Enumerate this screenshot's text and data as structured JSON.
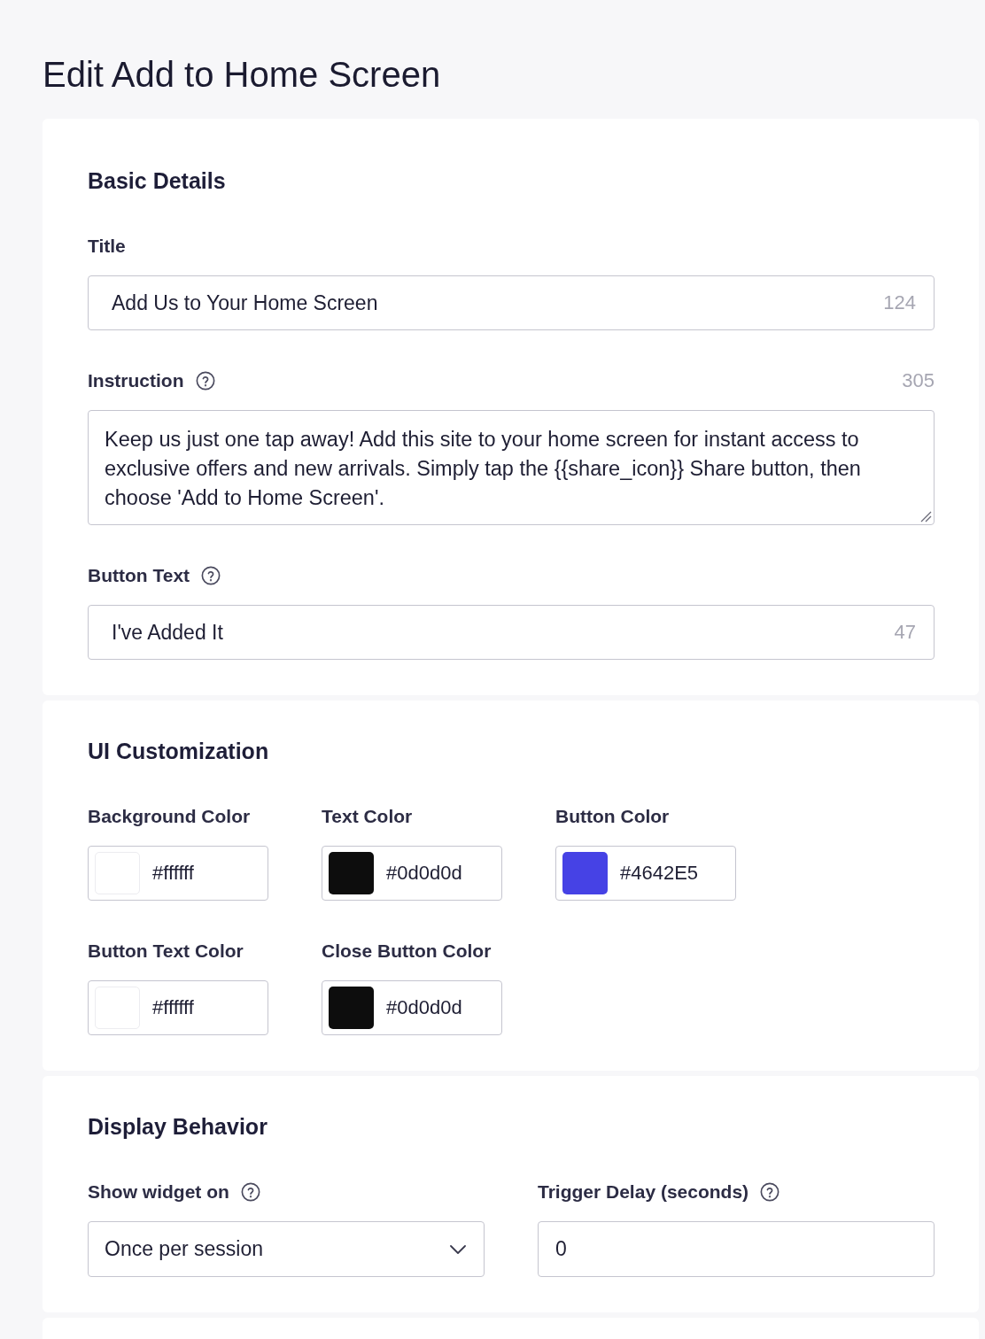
{
  "page": {
    "title": "Edit Add to Home Screen"
  },
  "sections": [
    {
      "kind": "stack",
      "title": "Basic Details",
      "fields": [
        {
          "kind": "text",
          "label": "Title",
          "help": false,
          "value": "Add Us to Your Home Screen",
          "counter": "124"
        },
        {
          "kind": "textarea",
          "label": "Instruction",
          "help": true,
          "counter": "305",
          "value": "Keep us just one tap away! Add this site to your home screen for instant access to exclusive offers and new arrivals. Simply tap the {{share_icon}} Share button, then choose 'Add to Home Screen'."
        },
        {
          "kind": "text",
          "label": "Button Text",
          "help": true,
          "value": "I've Added It",
          "counter": "47"
        }
      ]
    },
    {
      "kind": "colors",
      "title": "UI Customization",
      "fields": [
        {
          "label": "Background Color",
          "value": "#ffffff",
          "color": "#ffffff"
        },
        {
          "label": "Text Color",
          "value": "#0d0d0d",
          "color": "#0d0d0d"
        },
        {
          "label": "Button Color",
          "value": "#4642E5",
          "color": "#4642e5"
        },
        {
          "label": "Button Text Color",
          "value": "#ffffff",
          "color": "#ffffff"
        },
        {
          "label": "Close Button Color",
          "value": "#0d0d0d",
          "color": "#0d0d0d"
        }
      ]
    },
    {
      "kind": "columns",
      "title": "Display Behavior",
      "fields": [
        {
          "kind": "select",
          "label": "Show widget on",
          "help": true,
          "value": "Once per session"
        },
        {
          "kind": "number",
          "label": "Trigger Delay (seconds)",
          "help": true,
          "value": "0"
        }
      ]
    }
  ]
}
